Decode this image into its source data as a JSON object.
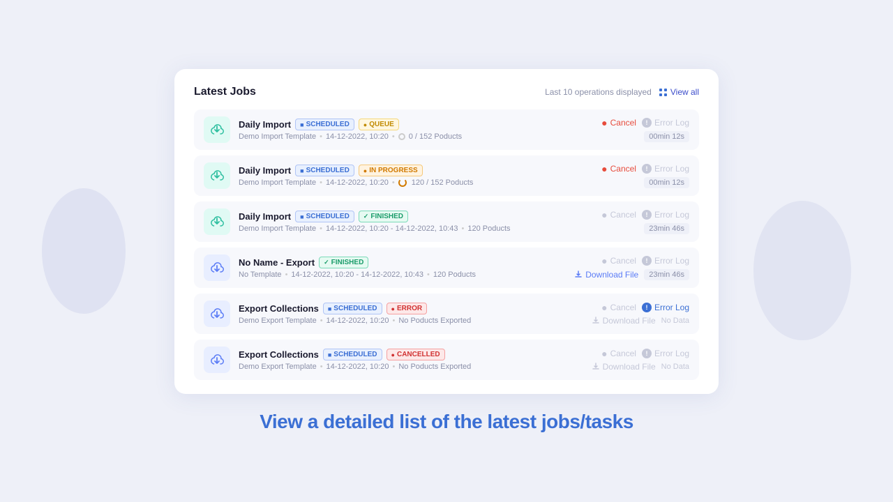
{
  "header": {
    "title": "Latest Jobs",
    "meta": "Last 10 operations displayed",
    "view_all": "View all"
  },
  "jobs": [
    {
      "id": 1,
      "type": "import",
      "name": "Daily Import",
      "badges": [
        {
          "label": "SCHEDULED",
          "type": "scheduled"
        },
        {
          "label": "QUEUE",
          "type": "queue"
        }
      ],
      "template": "Demo Import Template",
      "date": "14-12-2022, 10:20",
      "date_end": null,
      "progress": "0 / 152 Poducts",
      "progress_type": "radio",
      "cancel": "Cancel",
      "cancel_active": true,
      "error_log": "Error Log",
      "error_log_active": false,
      "download": null,
      "time": "00min 12s",
      "no_data": null
    },
    {
      "id": 2,
      "type": "import",
      "name": "Daily Import",
      "badges": [
        {
          "label": "SCHEDULED",
          "type": "scheduled"
        },
        {
          "label": "IN PROGRESS",
          "type": "inprogress"
        }
      ],
      "template": "Demo Import Template",
      "date": "14-12-2022, 10:20",
      "date_end": null,
      "progress": "120 / 152 Poducts",
      "progress_type": "spinner",
      "cancel": "Cancel",
      "cancel_active": true,
      "error_log": "Error Log",
      "error_log_active": false,
      "download": null,
      "time": "00min 12s",
      "no_data": null
    },
    {
      "id": 3,
      "type": "import",
      "name": "Daily Import",
      "badges": [
        {
          "label": "SCHEDULED",
          "type": "scheduled"
        },
        {
          "label": "FINISHED",
          "type": "finished"
        }
      ],
      "template": "Demo Import Template",
      "date": "14-12-2022, 10:20",
      "date_end": "14-12-2022, 10:43",
      "progress": "120 Poducts",
      "progress_type": null,
      "cancel": "Cancel",
      "cancel_active": false,
      "error_log": "Error Log",
      "error_log_active": false,
      "download": null,
      "time": "23min 46s",
      "no_data": null
    },
    {
      "id": 4,
      "type": "export",
      "name": "No Name - Export",
      "badges": [
        {
          "label": "FINISHED",
          "type": "finished"
        }
      ],
      "template": "No Template",
      "date": "14-12-2022, 10:20",
      "date_end": "14-12-2022, 10:43",
      "progress": "120 Poducts",
      "progress_type": null,
      "cancel": "Cancel",
      "cancel_active": false,
      "error_log": "Error Log",
      "error_log_active": false,
      "download": "Download File",
      "time": "23min 46s",
      "no_data": null
    },
    {
      "id": 5,
      "type": "export",
      "name": "Export Collections",
      "badges": [
        {
          "label": "SCHEDULED",
          "type": "scheduled"
        },
        {
          "label": "ERROR",
          "type": "error"
        }
      ],
      "template": "Demo Export Template",
      "date": "14-12-2022, 10:20",
      "date_end": null,
      "progress": "No Poducts Exported",
      "progress_type": null,
      "cancel": "Cancel",
      "cancel_active": false,
      "error_log": "Error Log",
      "error_log_active": true,
      "download": "Download File",
      "time": null,
      "no_data": "No Data"
    },
    {
      "id": 6,
      "type": "export",
      "name": "Export Collections",
      "badges": [
        {
          "label": "SCHEDULED",
          "type": "scheduled"
        },
        {
          "label": "CANCELLED",
          "type": "cancelled"
        }
      ],
      "template": "Demo Export Template",
      "date": "14-12-2022, 10:20",
      "date_end": null,
      "progress": "No Poducts Exported",
      "progress_type": null,
      "cancel": "Cancel",
      "cancel_active": false,
      "error_log": "Error Log",
      "error_log_active": false,
      "download": "Download File",
      "time": null,
      "no_data": "No Data"
    }
  ],
  "bottom_text": "View a detailed list of the latest jobs/tasks"
}
